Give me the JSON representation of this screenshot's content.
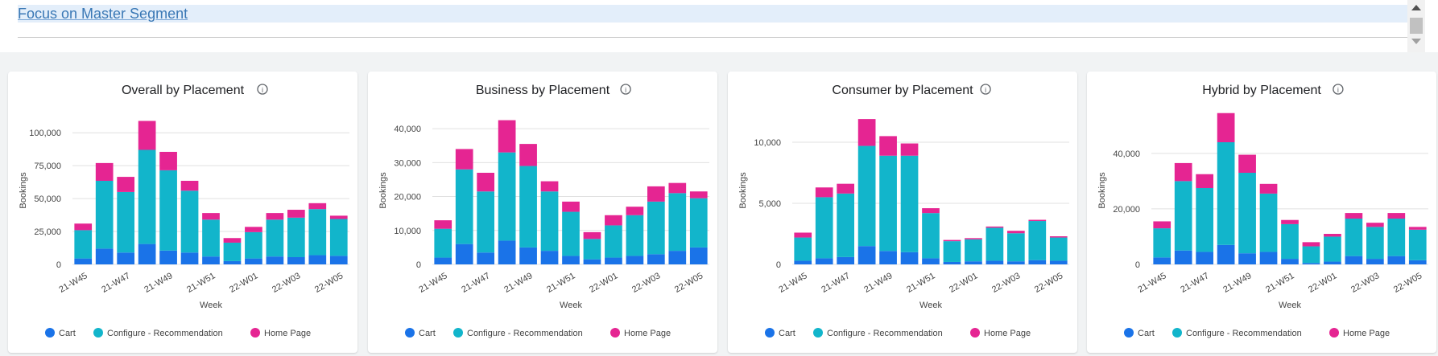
{
  "header": {
    "title": "Focus on Master Segment"
  },
  "colors": {
    "Cart": "#1a73e8",
    "Configure - Recommendation": "#12b5cb",
    "Home Page": "#e52592"
  },
  "chart_data": [
    {
      "type": "bar",
      "stacked": true,
      "title": "Overall by Placement",
      "xlabel": "Week",
      "ylabel": "Bookings",
      "categories": [
        "21-W45",
        "21-W46",
        "21-W47",
        "21-W48",
        "21-W49",
        "21-W50",
        "21-W51",
        "21-W52",
        "22-W01",
        "22-W02",
        "22-W03",
        "22-W04",
        "22-W05"
      ],
      "tick_labels": [
        "21-W45",
        "21-W47",
        "21-W49",
        "21-W51",
        "22-W01",
        "22-W03",
        "22-W05"
      ],
      "y_ticks": [
        0,
        25000,
        50000,
        75000,
        100000
      ],
      "y_tick_labels": [
        "0",
        "25,000",
        "50,000",
        "75,000",
        "100,000"
      ],
      "ylim": [
        0,
        116000
      ],
      "series": [
        {
          "name": "Cart",
          "values": [
            4500,
            12000,
            9000,
            15500,
            10500,
            9000,
            6000,
            2500,
            4500,
            6000,
            5500,
            7000,
            6500
          ]
        },
        {
          "name": "Configure - Recommendation",
          "values": [
            21500,
            51500,
            46000,
            71500,
            61000,
            47000,
            28000,
            14000,
            20000,
            28000,
            30000,
            35000,
            28000
          ]
        },
        {
          "name": "Home Page",
          "values": [
            5000,
            13500,
            11500,
            22000,
            14000,
            7500,
            5000,
            3500,
            4000,
            5000,
            6000,
            4500,
            2500
          ]
        }
      ],
      "legend": "bottom",
      "grid": true
    },
    {
      "type": "bar",
      "stacked": true,
      "title": "Business by Placement",
      "xlabel": "Week",
      "ylabel": "Bookings",
      "categories": [
        "21-W45",
        "21-W46",
        "21-W47",
        "21-W48",
        "21-W49",
        "21-W50",
        "21-W51",
        "21-W52",
        "22-W01",
        "22-W02",
        "22-W03",
        "22-W04",
        "22-W05"
      ],
      "tick_labels": [
        "21-W45",
        "21-W47",
        "21-W49",
        "21-W51",
        "22-W01",
        "22-W03",
        "22-W05"
      ],
      "y_ticks": [
        0,
        10000,
        20000,
        30000,
        40000
      ],
      "y_tick_labels": [
        "0",
        "10,000",
        "20,000",
        "30,000",
        "40,000"
      ],
      "ylim": [
        0,
        45000
      ],
      "series": [
        {
          "name": "Cart",
          "values": [
            2000,
            6000,
            3500,
            7000,
            5000,
            4000,
            2500,
            1500,
            2000,
            2500,
            3000,
            4000,
            5000
          ]
        },
        {
          "name": "Configure - Recommendation",
          "values": [
            8500,
            22000,
            18000,
            26000,
            24000,
            17500,
            13000,
            6000,
            9500,
            12000,
            15500,
            17000,
            14500
          ]
        },
        {
          "name": "Home Page",
          "values": [
            2500,
            6000,
            5500,
            9500,
            6500,
            3000,
            3000,
            2000,
            3000,
            2500,
            4500,
            3000,
            2000
          ]
        }
      ],
      "legend": "bottom",
      "grid": true
    },
    {
      "type": "bar",
      "stacked": true,
      "title": "Consumer by Placement",
      "xlabel": "Week",
      "ylabel": "Bookings",
      "categories": [
        "21-W45",
        "21-W46",
        "21-W47",
        "21-W48",
        "21-W49",
        "21-W50",
        "21-W51",
        "21-W52",
        "22-W01",
        "22-W02",
        "22-W03",
        "22-W04",
        "22-W05"
      ],
      "tick_labels": [
        "21-W45",
        "21-W47",
        "21-W49",
        "21-W51",
        "22-W01",
        "22-W03",
        "22-W05"
      ],
      "y_ticks": [
        0,
        5000,
        10000
      ],
      "y_tick_labels": [
        "0",
        "5,000",
        "10,000"
      ],
      "ylim": [
        0,
        12500
      ],
      "series": [
        {
          "name": "Cart",
          "values": [
            300,
            500,
            600,
            1500,
            1100,
            1000,
            500,
            200,
            250,
            300,
            250,
            350,
            300
          ]
        },
        {
          "name": "Configure - Recommendation",
          "values": [
            1900,
            5000,
            5200,
            8200,
            7800,
            7900,
            3700,
            1700,
            1800,
            2700,
            2300,
            3200,
            1900
          ]
        },
        {
          "name": "Home Page",
          "values": [
            400,
            800,
            800,
            2200,
            1600,
            1000,
            400,
            100,
            100,
            100,
            200,
            100,
            100
          ]
        }
      ],
      "legend": "bottom",
      "grid": true
    },
    {
      "type": "bar",
      "stacked": true,
      "title": "Hybrid by Placement",
      "xlabel": "Week",
      "ylabel": "Bookings",
      "categories": [
        "21-W45",
        "21-W46",
        "21-W47",
        "21-W48",
        "21-W49",
        "21-W50",
        "21-W51",
        "21-W52",
        "22-W01",
        "22-W02",
        "22-W03",
        "22-W04",
        "22-W05"
      ],
      "tick_labels": [
        "21-W45",
        "21-W47",
        "21-W49",
        "21-W51",
        "22-W01",
        "22-W03",
        "22-W05"
      ],
      "y_ticks": [
        0,
        20000,
        40000
      ],
      "y_tick_labels": [
        "0",
        "20,000",
        "40,000"
      ],
      "ylim": [
        0,
        55000
      ],
      "series": [
        {
          "name": "Cart",
          "values": [
            2500,
            5000,
            4500,
            7000,
            4000,
            4500,
            2000,
            500,
            1000,
            3000,
            2000,
            3000,
            1500
          ]
        },
        {
          "name": "Configure - Recommendation",
          "values": [
            10500,
            25000,
            23000,
            37000,
            29000,
            21000,
            12500,
            6000,
            9000,
            13500,
            11500,
            13500,
            11000
          ]
        },
        {
          "name": "Home Page",
          "values": [
            2500,
            6500,
            5000,
            10500,
            6500,
            3500,
            1500,
            1500,
            1000,
            2000,
            1500,
            2000,
            1000
          ]
        }
      ],
      "legend": "bottom",
      "grid": true
    }
  ]
}
